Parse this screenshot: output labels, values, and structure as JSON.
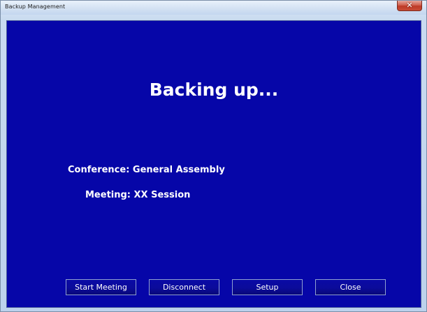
{
  "window": {
    "title": "Backup Management",
    "close_glyph": "✕"
  },
  "main": {
    "heading": "Backing up...",
    "conference_line": "Conference: General Assembly",
    "meeting_line": "Meeting: XX Session"
  },
  "buttons": {
    "start_meeting": "Start Meeting",
    "disconnect": "Disconnect",
    "setup": "Setup",
    "close": "Close"
  },
  "colors": {
    "panel_background": "#0606a8",
    "text": "#ffffff",
    "close_button": "#c84c36"
  }
}
